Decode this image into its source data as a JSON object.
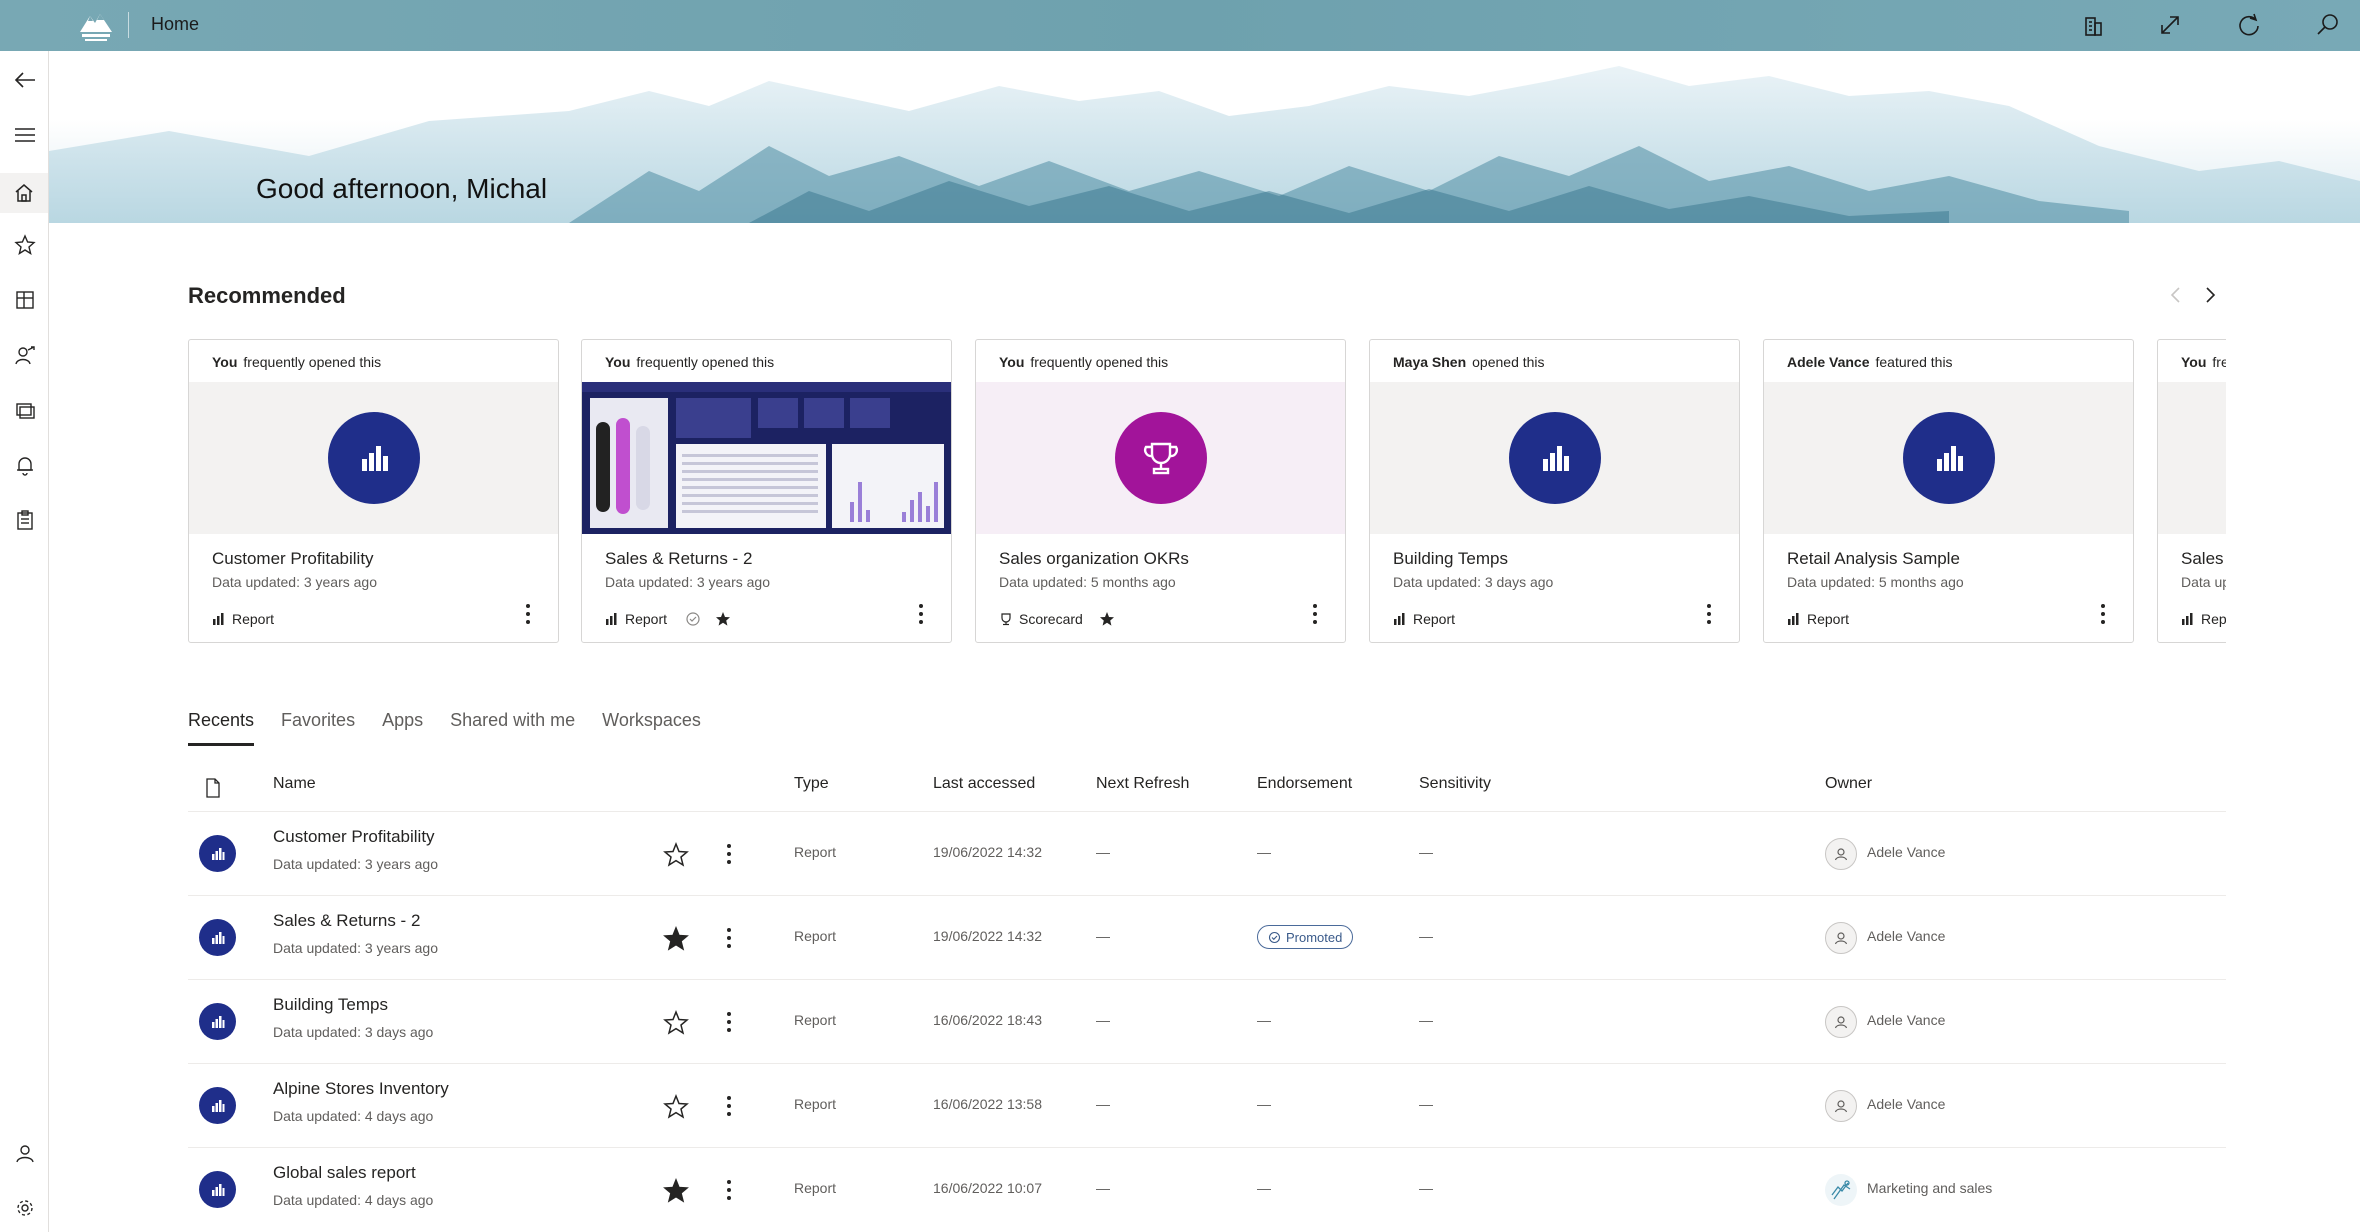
{
  "topbar": {
    "title": "Home",
    "icons": [
      "building-icon",
      "expand-icon",
      "refresh-icon",
      "search-icon"
    ]
  },
  "sidebar": {
    "items": [
      "back-arrow-icon",
      "menu-icon",
      "home-icon",
      "star-icon",
      "apps-icon",
      "shared-with-me-icon",
      "workspaces-icon",
      "bell-icon",
      "clipboard-icon"
    ],
    "bottom": [
      "person-icon",
      "gear-icon"
    ]
  },
  "hero": {
    "greeting": "Good afternoon, Michal"
  },
  "recommended": {
    "title": "Recommended",
    "cards": [
      {
        "who": "You",
        "action": "frequently opened this",
        "title": "Customer Profitability",
        "updated": "Data updated: 3 years ago",
        "type": "Report",
        "thumb": "report",
        "endorsed": false,
        "starred": false
      },
      {
        "who": "You",
        "action": "frequently opened this",
        "title": "Sales & Returns  - 2",
        "updated": "Data updated: 3 years ago",
        "type": "Report",
        "thumb": "screenshot",
        "endorsed": true,
        "starred": true
      },
      {
        "who": "You",
        "action": "frequently opened this",
        "title": "Sales organization OKRs",
        "updated": "Data updated: 5 months ago",
        "type": "Scorecard",
        "thumb": "scorecard",
        "endorsed": false,
        "starred": true
      },
      {
        "who": "Maya Shen",
        "action": "opened this",
        "title": "Building Temps",
        "updated": "Data updated: 3 days ago",
        "type": "Report",
        "thumb": "report",
        "endorsed": false,
        "starred": false
      },
      {
        "who": "Adele Vance",
        "action": "featured this",
        "title": "Retail Analysis Sample",
        "updated": "Data updated: 5 months ago",
        "type": "Report",
        "thumb": "report",
        "endorsed": false,
        "starred": false
      },
      {
        "who": "You",
        "action": "fre",
        "title": "Sales p",
        "updated": "Data up",
        "type": "Repo",
        "thumb": "report",
        "endorsed": false,
        "starred": false
      }
    ]
  },
  "tabs": [
    "Recents",
    "Favorites",
    "Apps",
    "Shared with me",
    "Workspaces"
  ],
  "table": {
    "columns": [
      "Name",
      "Type",
      "Last accessed",
      "Next Refresh",
      "Endorsement",
      "Sensitivity",
      "Owner"
    ],
    "rows": [
      {
        "name": "Customer Profitability",
        "updated": "Data updated: 3 years ago",
        "starred": false,
        "type": "Report",
        "last_accessed": "19/06/2022 14:32",
        "next_refresh": "—",
        "endorsement": "—",
        "sensitivity": "—",
        "owner": "Adele Vance",
        "owner_icon": "person-icon"
      },
      {
        "name": "Sales & Returns  - 2",
        "updated": "Data updated: 3 years ago",
        "starred": true,
        "type": "Report",
        "last_accessed": "19/06/2022 14:32",
        "next_refresh": "—",
        "endorsement": "Promoted",
        "sensitivity": "—",
        "owner": "Adele Vance",
        "owner_icon": "person-icon"
      },
      {
        "name": "Building Temps",
        "updated": "Data updated: 3 days ago",
        "starred": false,
        "type": "Report",
        "last_accessed": "16/06/2022 18:43",
        "next_refresh": "—",
        "endorsement": "—",
        "sensitivity": "—",
        "owner": "Adele Vance",
        "owner_icon": "person-icon"
      },
      {
        "name": "Alpine Stores Inventory",
        "updated": "Data updated: 4 days ago",
        "starred": false,
        "type": "Report",
        "last_accessed": "16/06/2022 13:58",
        "next_refresh": "—",
        "endorsement": "—",
        "sensitivity": "—",
        "owner": "Adele Vance",
        "owner_icon": "person-icon"
      },
      {
        "name": "Global sales report",
        "updated": "Data updated: 4 days ago",
        "starred": true,
        "type": "Report",
        "last_accessed": "16/06/2022 10:07",
        "next_refresh": "—",
        "endorsement": "—",
        "sensitivity": "—",
        "owner": "Marketing and sales",
        "owner_icon": "group-icon"
      }
    ]
  },
  "colors": {
    "topbar": "#6ea1ae",
    "report_icon": "#1f2e8a",
    "scorecard_icon": "#a2149a",
    "endorsement_badge": "#3a5a8a"
  }
}
